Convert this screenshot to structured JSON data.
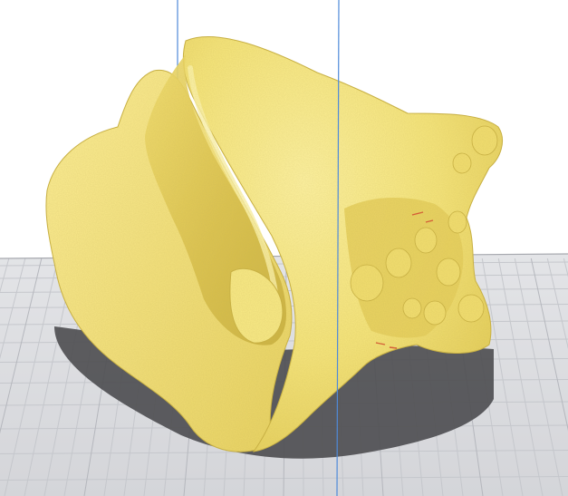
{
  "viewport": {
    "background_color": "#ffffff",
    "build_plate": {
      "plate_color": "#dadbdf",
      "grid_line_color": "#c5c7cc",
      "grid_major_line_color": "#b5b7bd",
      "edge_color": "#a7a9af"
    },
    "axes": {
      "vertical_axis_color": "#4f8ad9"
    },
    "model": {
      "object": "conch-shell",
      "body_color": "#f5e474",
      "highlight_color": "#fff4a6",
      "shade_color": "#d9c24a",
      "deep_shade_color": "#b79f2c",
      "overhang_marker_color": "#d8402e"
    },
    "shadow": {
      "color": "#4f4f52"
    }
  }
}
